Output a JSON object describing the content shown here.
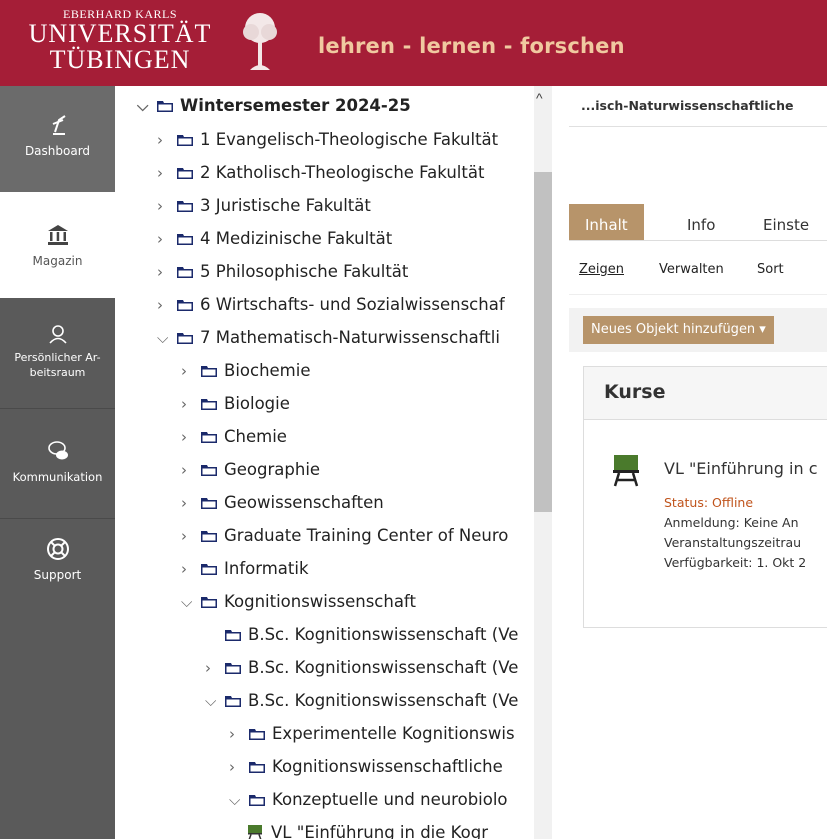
{
  "header": {
    "logo_line1": "EBERHARD KARLS",
    "logo_line2": "UNIVERSITÄT",
    "logo_line3": "TÜBINGEN",
    "motto": "lehren - lernen - forschen",
    "brand_color": "#a51e37"
  },
  "mainmenu": [
    {
      "label": "Dashboard",
      "icon": "dashboard-icon"
    },
    {
      "label": "Magazin",
      "icon": "bank-icon"
    },
    {
      "label": "Persönlicher Ar-beitsraum",
      "icon": "person-icon"
    },
    {
      "label": "Kommunikation",
      "icon": "chat-icon"
    },
    {
      "label": "Support",
      "icon": "lifebuoy-icon"
    }
  ],
  "tree": {
    "root": "Wintersemester 2024-25",
    "items": [
      "1 Evangelisch-Theologische Fakultät",
      "2 Katholisch-Theologische Fakultät",
      "3 Juristische Fakultät",
      "4 Medizinische Fakultät",
      "5 Philosophische Fakultät",
      "6 Wirtschafts- und Sozialwissenschaf",
      "7 Mathematisch-Naturwissenschaftli",
      "Biochemie",
      "Biologie",
      "Chemie",
      "Geographie",
      "Geowissenschaften",
      "Graduate Training Center of Neuro",
      "Informatik",
      "Kognitionswissenschaft",
      "B.Sc. Kognitionswissenschaft (Ve",
      "B.Sc. Kognitionswissenschaft (Ve",
      "B.Sc. Kognitionswissenschaft (Ve",
      "Experimentelle Kognitionswis",
      "Kognitionswissenschaftliche",
      "Konzeptuelle und neurobiolo",
      "VL \"Einführung in die Kogr"
    ]
  },
  "content": {
    "breadcrumb": "...isch-Naturwissenschaftliche",
    "tabs": [
      "Inhalt",
      "Info",
      "Einste"
    ],
    "subtabs": [
      "Zeigen",
      "Verwalten",
      "Sort"
    ],
    "add_button": "Neues Objekt hinzufügen ▾",
    "section_title": "Kurse",
    "course_title": "VL \"Einführung in c",
    "status": "Status: Offline",
    "anmeldung": "Anmeldung: Keine An",
    "zeitraum": "Veranstaltungszeitrau",
    "verfuegbarkeit": "Verfügbarkeit: 1. Okt 2"
  },
  "colors": {
    "accent": "#b7946a",
    "status_offline": "#c0541c",
    "sidebar": "#5a5a5a"
  }
}
